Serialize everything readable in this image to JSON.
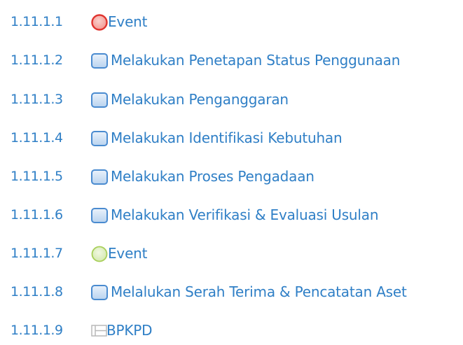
{
  "items": [
    {
      "number": "1.11.1.1",
      "label": "Event",
      "icon": "start-event-icon",
      "icon_color": "#e0342f"
    },
    {
      "number": "1.11.1.2",
      "label": "Melakukan Penetapan Status Penggunaan",
      "icon": "task-icon",
      "icon_color": "#4a8bd0"
    },
    {
      "number": "1.11.1.3",
      "label": "Melakukan Penganggaran",
      "icon": "task-icon",
      "icon_color": "#4a8bd0"
    },
    {
      "number": "1.11.1.4",
      "label": "Melakukan Identifikasi Kebutuhan",
      "icon": "task-icon",
      "icon_color": "#4a8bd0"
    },
    {
      "number": "1.11.1.5",
      "label": "Melakukan Proses Pengadaan",
      "icon": "task-icon",
      "icon_color": "#4a8bd0"
    },
    {
      "number": "1.11.1.6",
      "label": "Melakukan Verifikasi & Evaluasi Usulan",
      "icon": "task-icon",
      "icon_color": "#4a8bd0"
    },
    {
      "number": "1.11.1.7",
      "label": "Event",
      "icon": "end-event-icon",
      "icon_color": "#a8cf5a"
    },
    {
      "number": "1.11.1.8",
      "label": "Melalukan Serah Terima & Pencatatan Aset",
      "icon": "task-icon",
      "icon_color": "#4a8bd0"
    },
    {
      "number": "1.11.1.9",
      "label": "BPKPD",
      "icon": "pool-icon",
      "icon_color": "#b9b9b9"
    }
  ],
  "colors": {
    "text": "#2f7fc6",
    "background": "#ffffff"
  }
}
